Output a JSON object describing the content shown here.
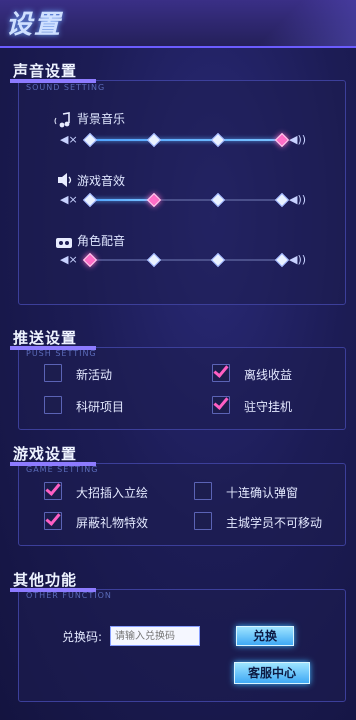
{
  "header": {
    "title": "设置"
  },
  "sound": {
    "title": "声音设置",
    "subtitle": "SOUND SETTING",
    "rows": [
      {
        "label": "背景音乐",
        "icon": "music-note-icon",
        "level": 1.0
      },
      {
        "label": "游戏音效",
        "icon": "speaker-icon",
        "level": 0.33
      },
      {
        "label": "角色配音",
        "icon": "voice-icon",
        "level": 0.0
      }
    ]
  },
  "push": {
    "title": "推送设置",
    "subtitle": "PUSH SETTING",
    "items": [
      {
        "label": "新活动",
        "checked": false
      },
      {
        "label": "离线收益",
        "checked": true
      },
      {
        "label": "科研项目",
        "checked": false
      },
      {
        "label": "驻守挂机",
        "checked": true
      }
    ]
  },
  "game": {
    "title": "游戏设置",
    "subtitle": "GAME SETTING",
    "items": [
      {
        "label": "大招插入立绘",
        "checked": true
      },
      {
        "label": "十连确认弹窗",
        "checked": false
      },
      {
        "label": "屏蔽礼物特效",
        "checked": true
      },
      {
        "label": "主城学员不可移动",
        "checked": false
      }
    ]
  },
  "other": {
    "title": "其他功能",
    "subtitle": "OTHER FUNCTION",
    "redeem_label": "兑换码:",
    "redeem_placeholder": "请输入兑换码",
    "redeem_button": "兑换",
    "service_button": "客服中心"
  },
  "colors": {
    "accent": "#8d7bff",
    "check": "#ff5fc3",
    "slider_fill": "#4fa3ff",
    "active_node": "#ff6ec7"
  }
}
